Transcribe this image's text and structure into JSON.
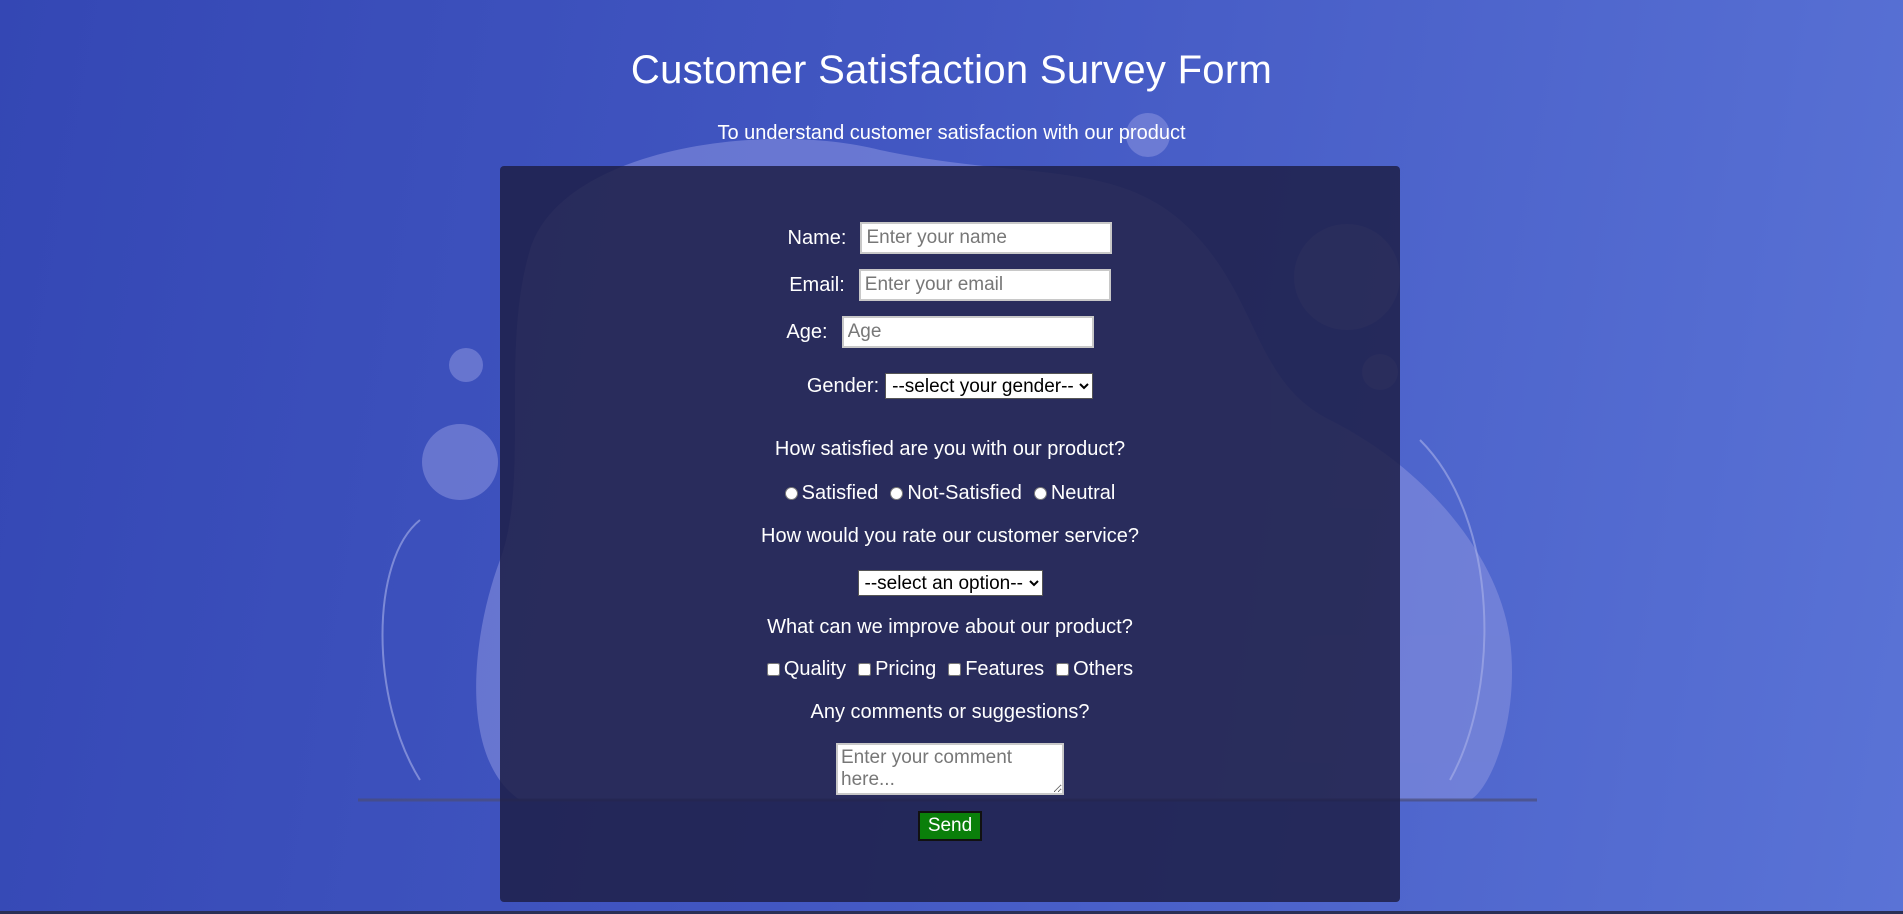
{
  "header": {
    "title": "Customer Satisfaction Survey Form",
    "subtitle": "To understand customer satisfaction with our product"
  },
  "form": {
    "name": {
      "label": "Name:",
      "placeholder": "Enter your name",
      "value": ""
    },
    "email": {
      "label": "Email:",
      "placeholder": "Enter your email",
      "value": ""
    },
    "age": {
      "label": "Age:",
      "placeholder": "Age",
      "value": ""
    },
    "gender": {
      "label": "Gender:",
      "selected": "--select your gender--"
    },
    "satisfaction": {
      "question": "How satisfied are you with our product?",
      "options": [
        "Satisfied",
        "Not-Satisfied",
        "Neutral"
      ]
    },
    "service": {
      "question": "How would you rate our customer service?",
      "selected": "--select an option--"
    },
    "improve": {
      "question": "What can we improve about our product?",
      "options": [
        "Quality",
        "Pricing",
        "Features",
        "Others"
      ]
    },
    "comments": {
      "question": "Any comments or suggestions?",
      "placeholder": "Enter your comment here..."
    },
    "send_label": "Send"
  },
  "colors": {
    "background_start": "#3447b4",
    "background_end": "#5a73d6",
    "panel": "#1e2048",
    "send_button": "#0a7f0a"
  }
}
